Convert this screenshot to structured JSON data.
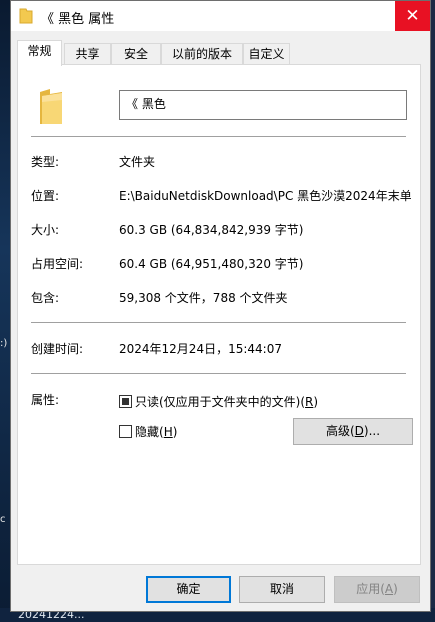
{
  "window": {
    "title": "《 黑色 属性",
    "close_symbol": "✕"
  },
  "tabs": [
    {
      "label": "常规"
    },
    {
      "label": "共享"
    },
    {
      "label": "安全"
    },
    {
      "label": "以前的版本"
    },
    {
      "label": "自定义"
    }
  ],
  "general": {
    "name_value": "《 黑色",
    "type_label": "类型:",
    "type_value": "文件夹",
    "location_label": "位置:",
    "location_value": "E:\\BaiduNetdiskDownload\\PC 黑色沙漠2024年末单",
    "size_label": "大小:",
    "size_value": "60.3 GB (64,834,842,939 字节)",
    "size_on_disk_label": "占用空间:",
    "size_on_disk_value": "60.4 GB (64,951,480,320 字节)",
    "contains_label": "包含:",
    "contains_value": "59,308 个文件，788 个文件夹",
    "created_label": "创建时间:",
    "created_value": "2024年12月24日，15:44:07",
    "attributes_label": "属性:",
    "readonly_text": "只读(仅应用于文件夹中的文件)(",
    "readonly_key": "R",
    "readonly_close": ")",
    "hidden_text": "隐藏(",
    "hidden_key": "H",
    "hidden_close": ")",
    "advanced_text": "高级(",
    "advanced_key": "D",
    "advanced_close": ")..."
  },
  "buttons": {
    "ok": "确定",
    "cancel": "取消",
    "apply_text": "应用(",
    "apply_key": "A",
    "apply_close": ")"
  },
  "desktop": {
    "frag1": ":)",
    "frag2": "c",
    "taskbar_text": "20241224..."
  },
  "icons": {
    "folder": "folder-icon",
    "close": "close-icon"
  },
  "colors": {
    "close_bg": "#e81123",
    "primary_border": "#0078d7",
    "folder": "#f3c94f"
  }
}
